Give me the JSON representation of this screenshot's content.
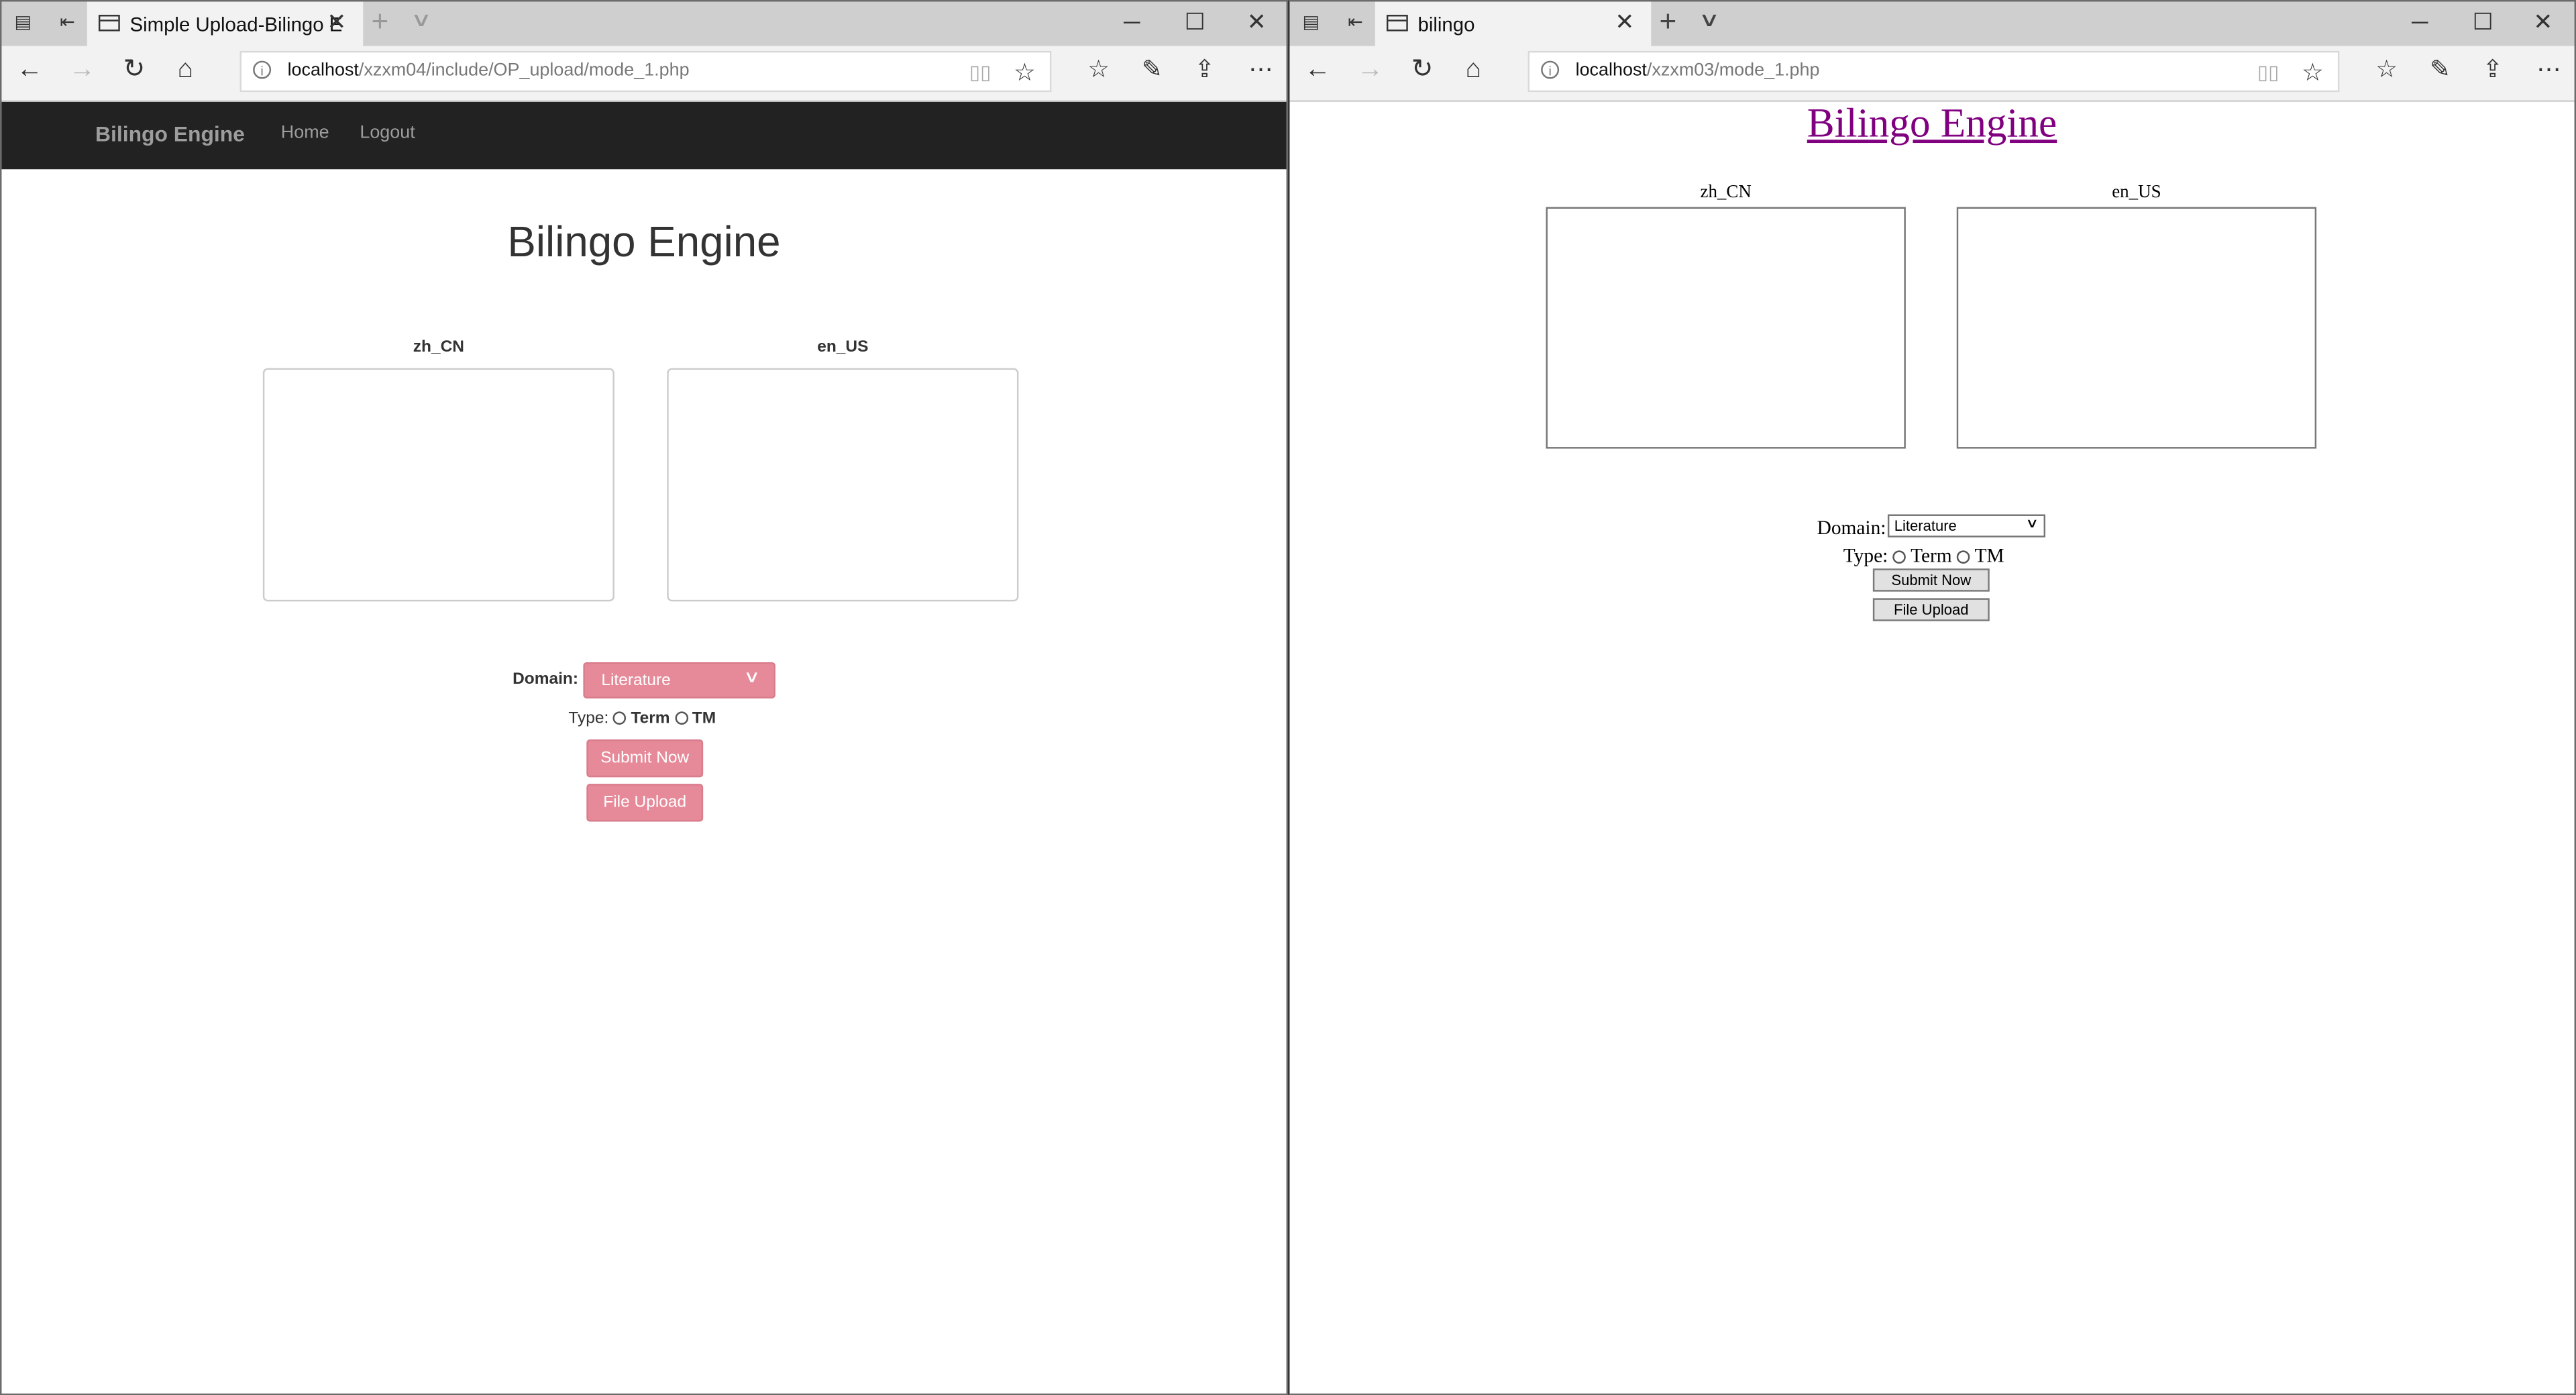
{
  "left_window": {
    "tab_title": "Simple Upload-Bilingo E",
    "url_host": "localhost",
    "url_path": "/xzxm04/include/OP_upload/mode_1.php",
    "page": {
      "nav_brand": "Bilingo Engine",
      "nav_links": [
        "Home",
        "Logout"
      ],
      "title": "Bilingo Engine",
      "source_label": "zh_CN",
      "target_label": "en_US",
      "domain_label": "Domain:",
      "domain_value": "Literature",
      "type_label": "Type:",
      "type_options": [
        "Term",
        "TM"
      ],
      "submit_label": "Submit Now",
      "upload_label": "File Upload",
      "accent_color": "#e68a9a"
    }
  },
  "right_window": {
    "tab_title": "bilingo",
    "url_host": "localhost",
    "url_path": "/xzxm03/mode_1.php",
    "page": {
      "title": "Bilingo Engine",
      "source_label": "zh_CN",
      "target_label": "en_US",
      "domain_label": "Domain:",
      "domain_value": "Literature",
      "type_label": "Type:",
      "type_options": [
        "Term",
        "TM"
      ],
      "submit_label": "Submit Now",
      "upload_label": "File Upload",
      "link_color": "#800080"
    }
  },
  "icons": {
    "tabs_aside": "tabs-aside-icon",
    "set_aside": "set-aside-icon",
    "page_tab": "page-icon",
    "close_tab": "close-icon",
    "new_tab": "plus-icon",
    "tab_list": "chevron-down-icon",
    "minimize": "minimize-icon",
    "maximize": "maximize-icon",
    "close_window": "close-icon",
    "back": "back-arrow-icon",
    "forward": "forward-arrow-icon",
    "refresh": "refresh-icon",
    "home": "home-icon",
    "site_info": "info-icon",
    "reading_view": "reading-view-icon",
    "favorite": "star-icon",
    "favorites": "favorites-icon",
    "notes": "pen-icon",
    "share": "share-icon",
    "more": "more-icon"
  }
}
